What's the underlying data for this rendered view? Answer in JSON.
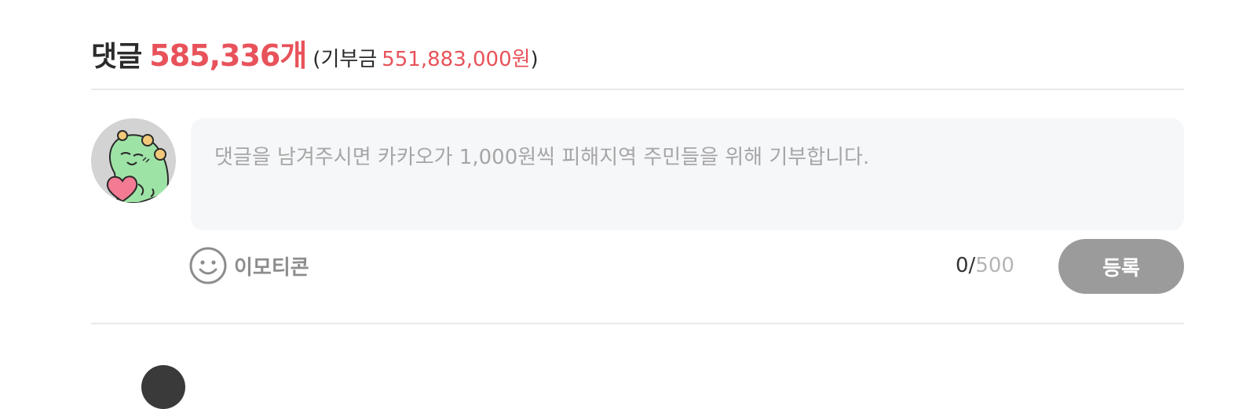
{
  "comments": {
    "header_label": "댓글",
    "count": "585,336개",
    "paren_open": "(",
    "donation_label": "기부금",
    "donation_value": "551,883,000원",
    "paren_close": ")"
  },
  "composer": {
    "placeholder": "댓글을 남겨주시면 카카오가 1,000원씩 피해지역 주민들을 위해 기부합니다.",
    "emoticon_label": "이모티콘",
    "char_count": "0",
    "char_separator": "/",
    "char_max": "500",
    "submit_label": "등록"
  },
  "colors": {
    "accent": "#e8525a",
    "submit_disabled": "#9b9b9b",
    "input_bg": "#f6f7f9",
    "avatar_green": "#9ee3a6",
    "heart_pink": "#f27b93"
  },
  "icons": {
    "avatar": "dino-holding-heart-icon",
    "emoticon": "smiley-face-icon"
  }
}
